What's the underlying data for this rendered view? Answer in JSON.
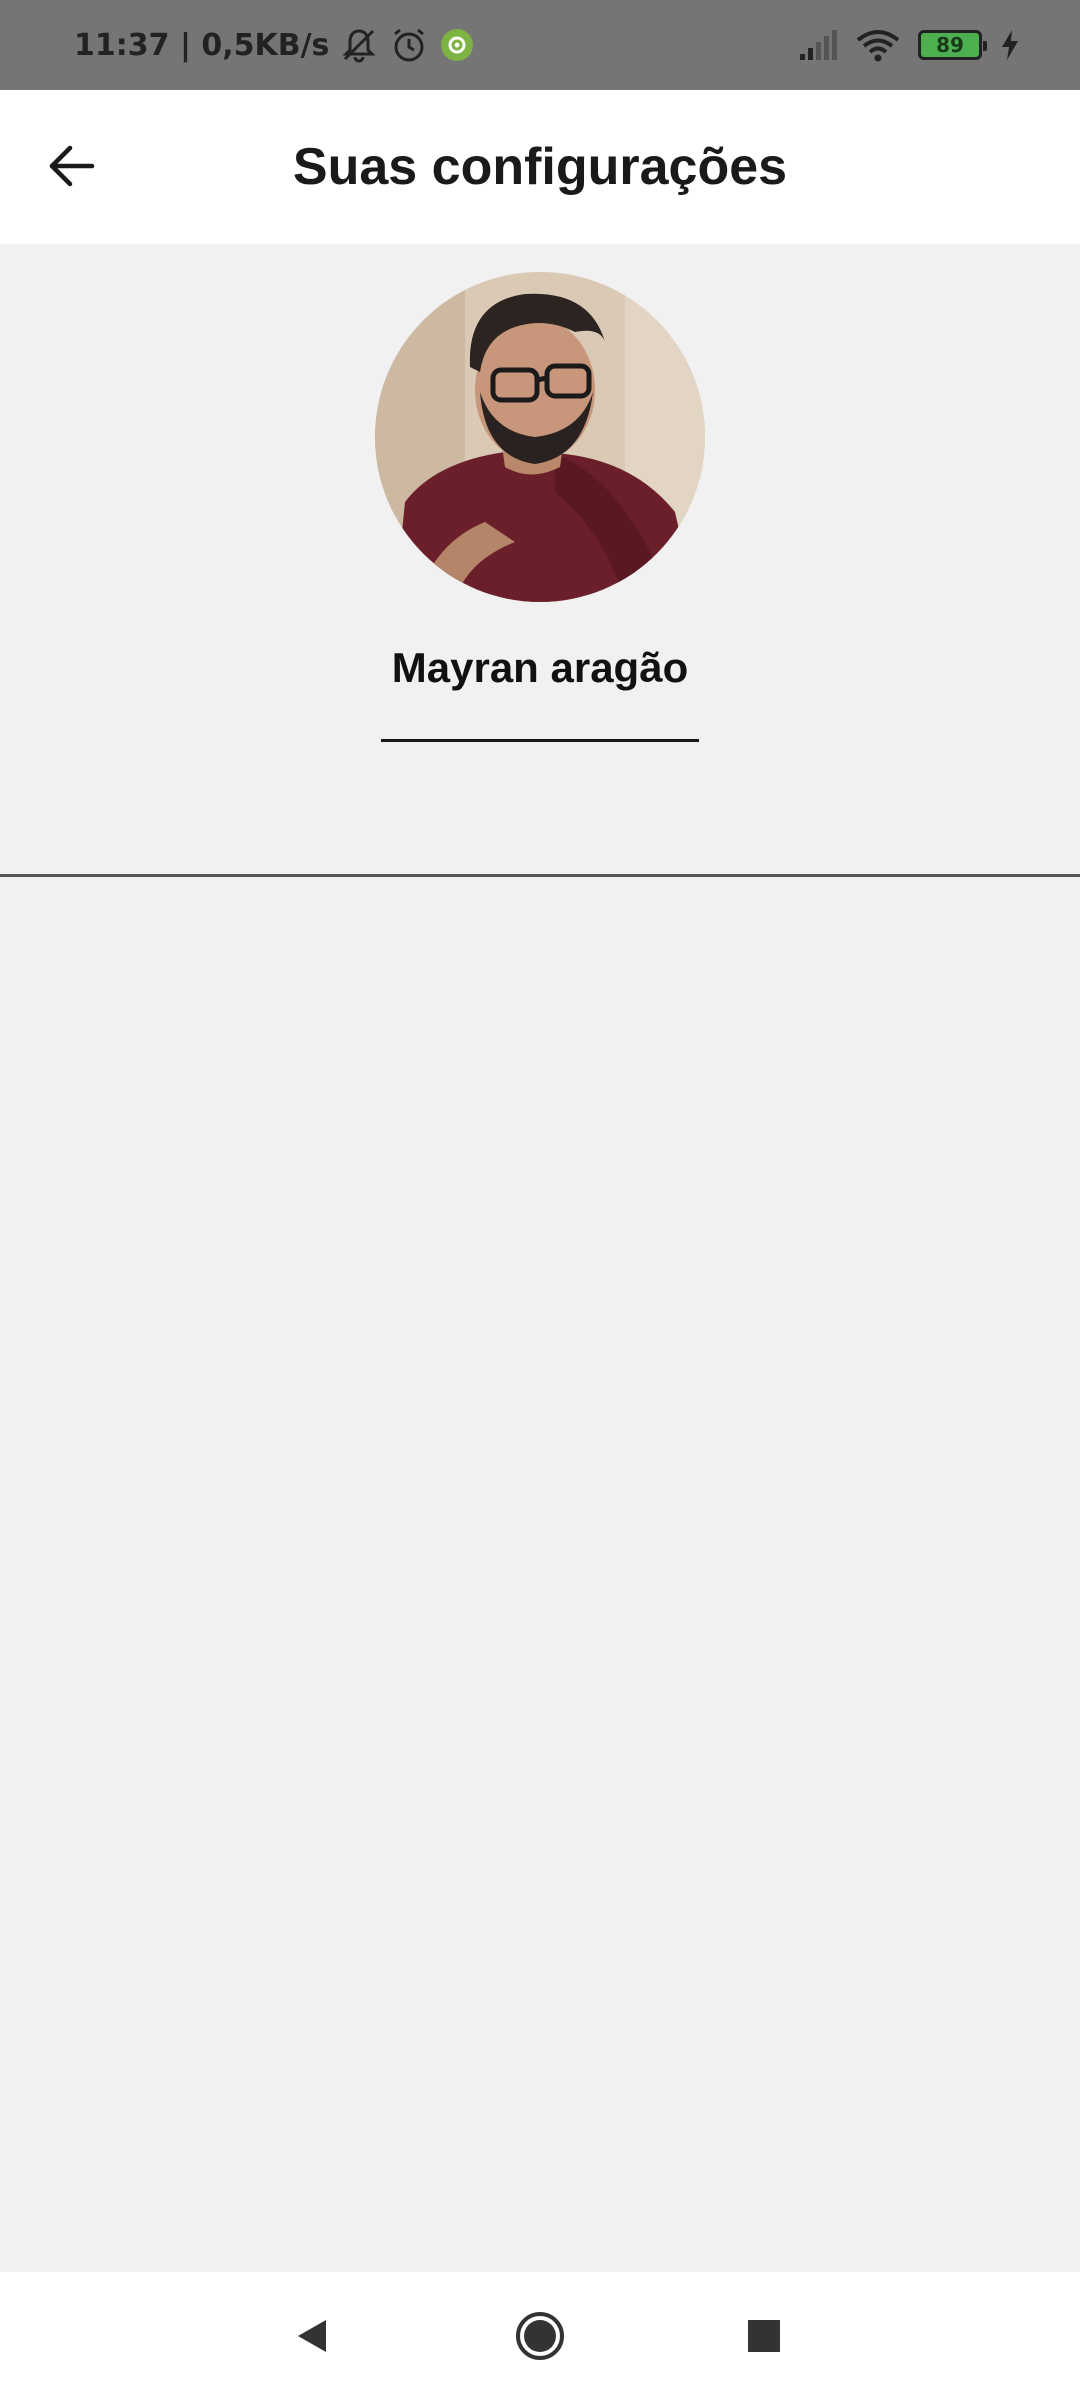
{
  "status_bar": {
    "time_speed": "11:37 | 0,5KB/s",
    "battery_level": "89",
    "icons": [
      "mute-bell-icon",
      "alarm-icon",
      "app-notification-icon",
      "signal-icon",
      "wifi-icon",
      "battery-icon",
      "charging-icon"
    ]
  },
  "header": {
    "title": "Suas configurações",
    "back_icon": "arrow-left-icon"
  },
  "profile": {
    "name": "Mayran aragão",
    "avatar_icon": "profile-photo"
  },
  "nav_bar": {
    "icons": [
      "back-triangle-icon",
      "home-circle-icon",
      "recents-square-icon"
    ]
  }
}
